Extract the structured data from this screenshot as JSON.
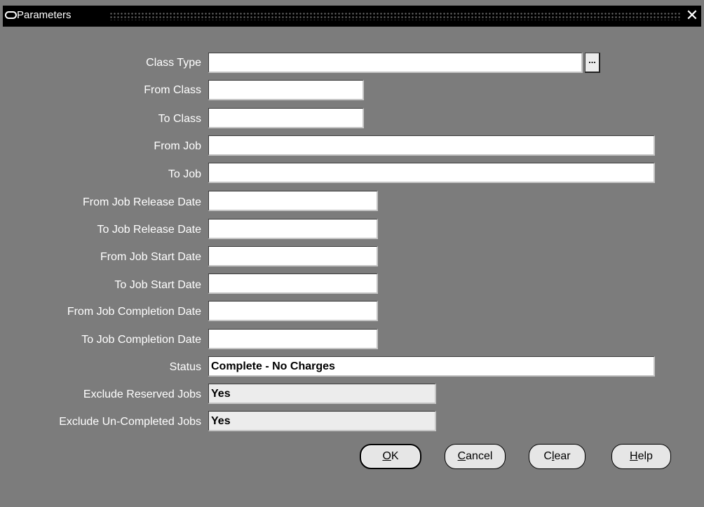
{
  "window": {
    "title": "Parameters",
    "close_glyph": "✕"
  },
  "form": {
    "fields": [
      {
        "label": "Class Type",
        "value": ""
      },
      {
        "label": "From Class",
        "value": ""
      },
      {
        "label": "To Class",
        "value": ""
      },
      {
        "label": "From Job",
        "value": ""
      },
      {
        "label": "To Job",
        "value": ""
      },
      {
        "label": "From Job Release Date",
        "value": ""
      },
      {
        "label": "To Job Release Date",
        "value": ""
      },
      {
        "label": "From Job Start Date",
        "value": ""
      },
      {
        "label": "To Job Start Date",
        "value": ""
      },
      {
        "label": "From Job Completion Date",
        "value": ""
      },
      {
        "label": "To Job Completion Date",
        "value": ""
      },
      {
        "label": "Status",
        "value": "Complete - No Charges"
      },
      {
        "label": "Exclude Reserved Jobs",
        "value": "Yes"
      },
      {
        "label": "Exclude Un-Completed Jobs",
        "value": "Yes"
      }
    ],
    "lov_glyph": "..."
  },
  "buttons": {
    "ok": {
      "mnemonic": "O",
      "rest": "K"
    },
    "cancel": {
      "mnemonic": "C",
      "rest": "ancel"
    },
    "clear": {
      "pre": "C",
      "mnemonic": "l",
      "rest": "ear"
    },
    "help": {
      "mnemonic": "H",
      "rest": "elp"
    }
  },
  "colors": {
    "background": "#7c7c7c",
    "titlebar": "#000000",
    "field": "#ffffff",
    "readonly_field": "#ececec"
  }
}
